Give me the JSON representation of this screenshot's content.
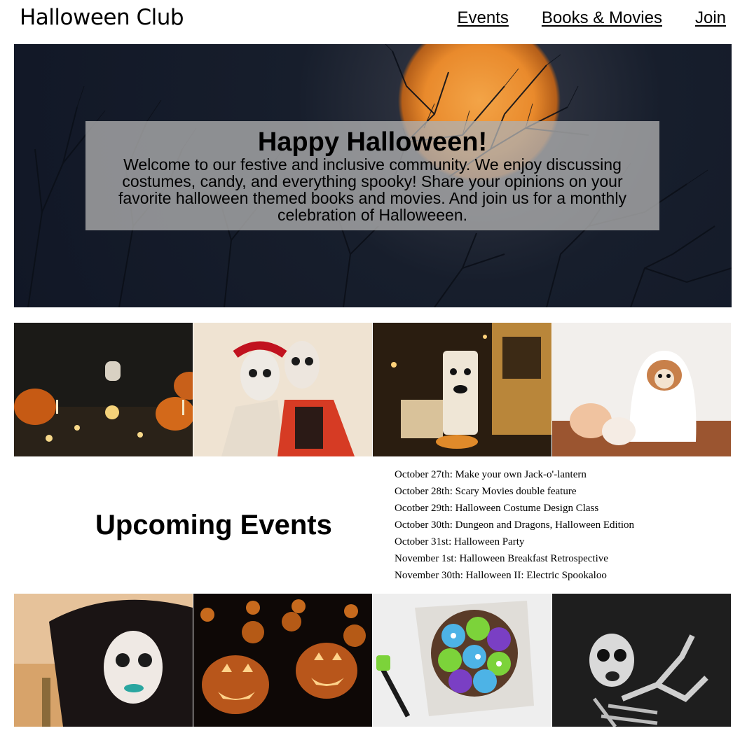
{
  "site": {
    "title": "Halloween Club"
  },
  "nav": {
    "items": [
      "Events",
      "Books & Movies",
      "Join"
    ]
  },
  "hero": {
    "title": "Happy Halloween!",
    "text": "Welcome to our festive and inclusive community. We enjoy discussing costumes, candy, and everything spooky! Share your opinions on your favorite halloween themed books and movies. And join us for a monthly celebration of Halloweeen."
  },
  "events": {
    "heading": "Upcoming Events",
    "items": [
      "October 27th: Make your own Jack-o'-lantern",
      "October 28th: Scary Movies double feature",
      "Ocotber 29th: Halloween Costume Design Class",
      "October 30th: Dungeon and Dragons, Halloween Edition",
      "October 31st: Halloween Party",
      "November 1st: Halloween Breakfast Retrospective",
      "November 30th: Halloween II: Electric Spookaloo"
    ]
  },
  "icons": {
    "hero": "full-moon-trees-photo",
    "top_row": [
      "pumpkins-candles-photo",
      "day-of-the-dead-couple-photo",
      "decorated-porch-photo",
      "dog-ghost-costume-photo"
    ],
    "bottom_row": [
      "sugar-skull-makeup-photo",
      "jack-o-lanterns-photo",
      "monster-cookies-photo",
      "skeleton-photo"
    ]
  },
  "colors": {
    "hero_overlay": "#afafaf",
    "moon": "#e98a2c",
    "night_sky": "#111726"
  }
}
